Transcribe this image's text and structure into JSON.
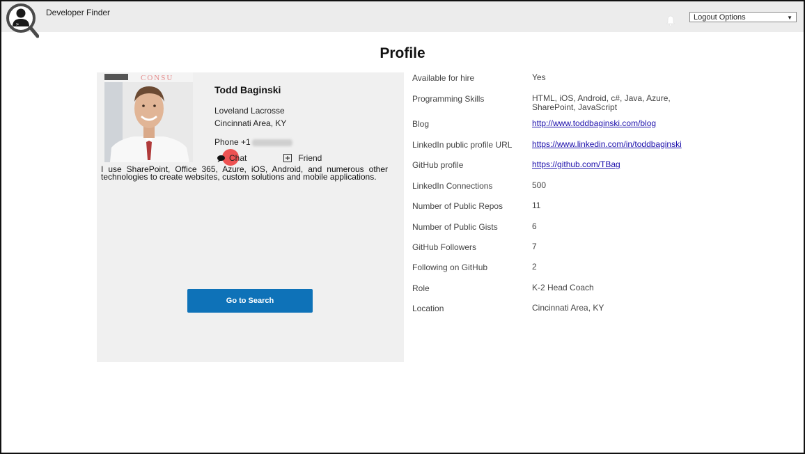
{
  "header": {
    "app_title": "Developer Finder",
    "logout_select": "Logout Options",
    "logout_arrow": "▼"
  },
  "page": {
    "title": "Profile"
  },
  "profile": {
    "name": "Todd Baginski",
    "company": "Loveland Lacrosse",
    "location": "Cincinnati Area, KY",
    "phone_prefix": "Phone +1",
    "chat_label": "Chat",
    "friend_label": "Friend",
    "photo_sign_text": "CONSU",
    "bio": "I use SharePoint, Office 365, Azure, iOS, Android, and numerous other technologies to create websites, custom solutions and mobile applications.",
    "go_search_label": "Go to Search"
  },
  "details": [
    {
      "key": "Available for hire",
      "value": "Yes",
      "link": false
    },
    {
      "key": "Programming Skills",
      "value": "HTML, iOS, Android, c#, Java, Azure, SharePoint, JavaScript",
      "link": false
    },
    {
      "key": "Blog",
      "value": "http://www.toddbaginski.com/blog",
      "link": true
    },
    {
      "key": "LinkedIn public profile URL",
      "value": "https://www.linkedin.com/in/toddbaginski",
      "link": true
    },
    {
      "key": "GitHub profile",
      "value": "https://github.com/TBag",
      "link": true
    },
    {
      "key": "LinkedIn Connections",
      "value": "500",
      "link": false
    },
    {
      "key": "Number of Public Repos",
      "value": "11",
      "link": false
    },
    {
      "key": "Number of Public Gists",
      "value": "6",
      "link": false
    },
    {
      "key": "GitHub Followers",
      "value": "7",
      "link": false
    },
    {
      "key": "Following on GitHub",
      "value": "2",
      "link": false
    },
    {
      "key": "Role",
      "value": "K-2 Head Coach",
      "link": false
    },
    {
      "key": "Location",
      "value": "Cincinnati Area, KY",
      "link": false
    }
  ],
  "colors": {
    "topbar": "#ececec",
    "card": "#f0f0f0",
    "button": "#0e72b8",
    "link": "#1a0dab",
    "cursor": "#ec3636"
  },
  "icons": {
    "logo": "developer-search-icon",
    "bell": "bell-icon",
    "chat": "chat-bubble-icon",
    "friend": "plus-square-icon"
  }
}
